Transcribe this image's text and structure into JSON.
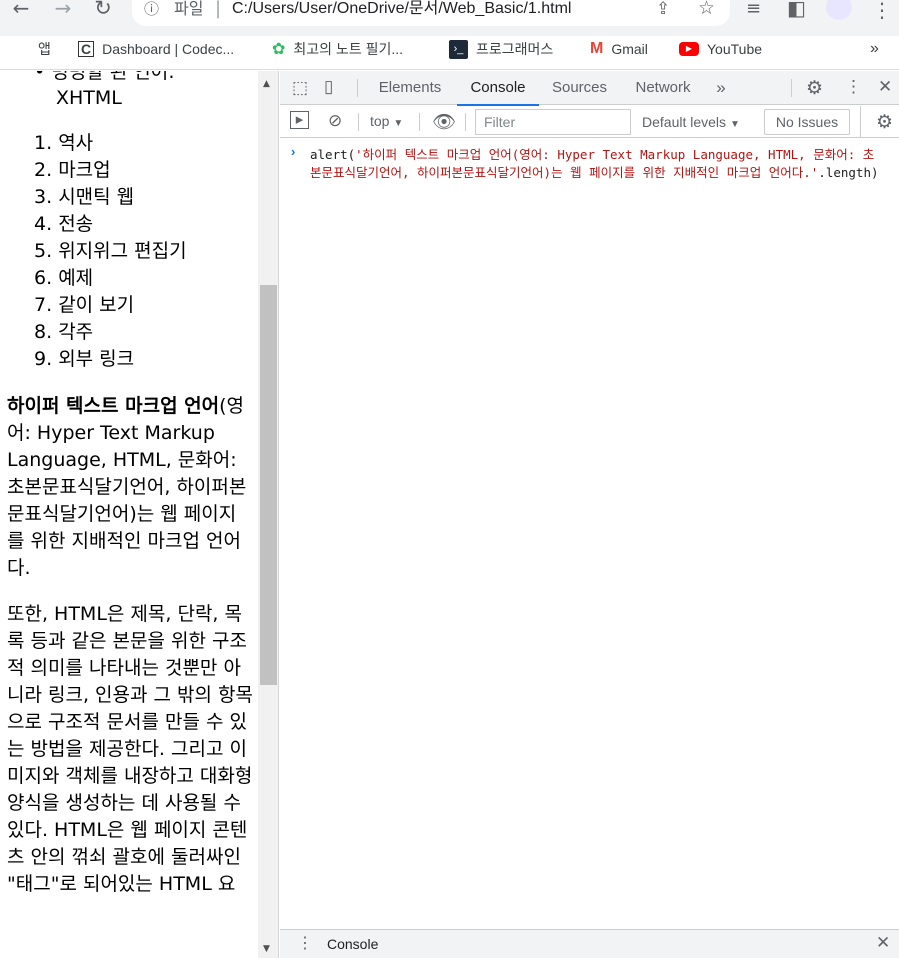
{
  "browser": {
    "omnibox": {
      "info_icon": "info-icon",
      "scheme_label": "파일",
      "url": "C:/Users/User/OneDrive/문서/Web_Basic/1.html"
    },
    "bookmarks": [
      {
        "label": "앱",
        "icon": "apps-grid-icon"
      },
      {
        "label": "Dashboard | Codec...",
        "icon": "codecademy-icon"
      },
      {
        "label": "최고의 노트 필기...",
        "icon": "evernote-icon"
      },
      {
        "label": "프로그래머스",
        "icon": "programmers-icon"
      },
      {
        "label": "Gmail",
        "icon": "gmail-icon"
      },
      {
        "label": "YouTube",
        "icon": "youtube-icon"
      }
    ],
    "bookmarks_overflow": "»"
  },
  "page": {
    "bullet_partial": "• 명명할 된 언어:",
    "bullet_xhtml": "XHTML",
    "toc": [
      {
        "num": "1.",
        "label": "역사"
      },
      {
        "num": "2.",
        "label": "마크업"
      },
      {
        "num": "3.",
        "label": "시맨틱 웹"
      },
      {
        "num": "4.",
        "label": "전송"
      },
      {
        "num": "5.",
        "label": "위지위그 편집기"
      },
      {
        "num": "6.",
        "label": "예제"
      },
      {
        "num": "7.",
        "label": "같이 보기"
      },
      {
        "num": "8.",
        "label": "각주"
      },
      {
        "num": "9.",
        "label": "외부 링크"
      }
    ],
    "para1_bold": "하이퍼 텍스트 마크업 언어",
    "para1_rest": "(영어: Hyper Text Markup Language, HTML, 문화어: 초본문표식달기언어, 하이퍼본문표식달기언어)는 웹 페이지를 위한 지배적인 마크업 언어다.",
    "para2": "또한, HTML은 제목, 단락, 목록 등과 같은 본문을 위한 구조적 의미를 나타내는 것뿐만 아니라 링크, 인용과 그 밖의 항목으로 구조적 문서를 만들 수 있는 방법을 제공한다. 그리고 이미지와 객체를 내장하고 대화형 양식을 생성하는 데 사용될 수 있다. HTML은 웹 페이지 콘텐츠 안의 꺾쇠 괄호에 둘러싸인 \"태그\"로 되어있는 HTML 요"
  },
  "devtools": {
    "tabs": [
      "Elements",
      "Console",
      "Sources",
      "Network"
    ],
    "active_tab": "Console",
    "more_tabs": "»",
    "context": "top",
    "filter_placeholder": "Filter",
    "levels": "Default levels",
    "issues": "No Issues",
    "console_input": {
      "prefix": "alert(",
      "string": "'하이퍼 텍스트 마크업 언어(영어: Hyper Text Markup Language, HTML, 문화어: 초본문표식달기언어, 하이퍼본문표식달기언어)는 웹 페이지를 위한 지배적인 마크업 언어다.'",
      "suffix": ".length)"
    },
    "drawer_title": "Console"
  },
  "colors": {
    "accent": "#1a73e8",
    "console_string": "#b31412",
    "youtube": "#ff0000",
    "evernote": "#2dbe60"
  }
}
